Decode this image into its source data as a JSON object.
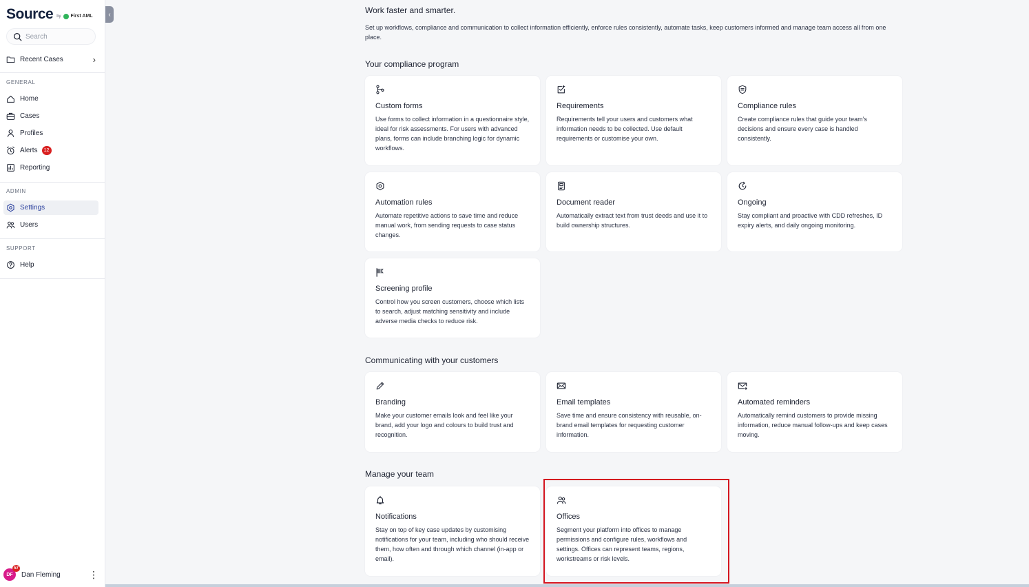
{
  "sidebar": {
    "logo": {
      "main": "Source",
      "by": "by",
      "sub": "First AML"
    },
    "search": {
      "placeholder": "Search"
    },
    "recent_cases": "Recent Cases",
    "sections": {
      "general": "GENERAL",
      "admin": "ADMIN",
      "support": "SUPPORT"
    },
    "items": {
      "home": "Home",
      "cases": "Cases",
      "profiles": "Profiles",
      "alerts": "Alerts",
      "alerts_badge": "12",
      "reporting": "Reporting",
      "settings": "Settings",
      "users": "Users",
      "help": "Help"
    },
    "user": {
      "initials": "DF",
      "count": "57",
      "name": "Dan Fleming"
    }
  },
  "main": {
    "title": "Work faster and smarter.",
    "description": "Set up workflows, compliance and communication to collect information efficiently, enforce rules consistently, automate tasks, keep customers informed and manage team access all from one place.",
    "groups": {
      "compliance": {
        "heading": "Your compliance program",
        "cards": [
          {
            "icon": "branch-icon",
            "title": "Custom forms",
            "desc": "Use forms to collect information in a questionnaire style, ideal for risk assessments. For users with advanced plans, forms can include branching logic for dynamic workflows."
          },
          {
            "icon": "checklist-icon",
            "title": "Requirements",
            "desc": "Requirements tell your users and customers what information needs to be collected. Use default requirements or customise your own."
          },
          {
            "icon": "shield-list-icon",
            "title": "Compliance rules",
            "desc": "Create compliance rules that guide your team’s decisions and ensure every case is handled consistently."
          },
          {
            "icon": "cog-hex-icon",
            "title": "Automation rules",
            "desc": "Automate repetitive actions to save time and reduce manual work, from sending requests to case status changes."
          },
          {
            "icon": "document-scan-icon",
            "title": "Document reader",
            "desc": "Automatically extract text from trust deeds and use it to build ownership structures."
          },
          {
            "icon": "refresh-clock-icon",
            "title": "Ongoing",
            "desc": "Stay compliant and proactive with CDD refreshes, ID expiry alerts, and daily ongoing monitoring."
          },
          {
            "icon": "flag-icon",
            "title": "Screening profile",
            "desc": "Control how you screen customers, choose which lists to search, adjust matching sensitivity and include adverse media checks to reduce risk."
          }
        ]
      },
      "communicating": {
        "heading": "Communicating with your customers",
        "cards": [
          {
            "icon": "pencil-icon",
            "title": "Branding",
            "desc": "Make your customer emails look and feel like your brand, add your logo and colours to build trust and recognition."
          },
          {
            "icon": "envelope-icon",
            "title": "Email templates",
            "desc": "Save time and ensure consistency with reusable, on-brand email templates for requesting customer information."
          },
          {
            "icon": "envelope-arrow-icon",
            "title": "Automated reminders",
            "desc": "Automatically remind customers to provide missing information, reduce manual follow-ups and keep cases moving."
          }
        ]
      },
      "team": {
        "heading": "Manage your team",
        "cards": [
          {
            "icon": "bell-icon",
            "title": "Notifications",
            "desc": "Stay on top of key case updates by customising notifications for your team, including who should receive them, how often and through which channel (in-app or email)."
          },
          {
            "icon": "users-icon",
            "title": "Offices",
            "desc": "Segment your platform into offices to manage permissions and configure rules, workflows and settings. Offices can represent teams, regions, workstreams or risk levels."
          }
        ]
      }
    }
  },
  "colors": {
    "accent": "#2a3f9d",
    "highlight": "#d4141f",
    "badge": "#d92121"
  }
}
